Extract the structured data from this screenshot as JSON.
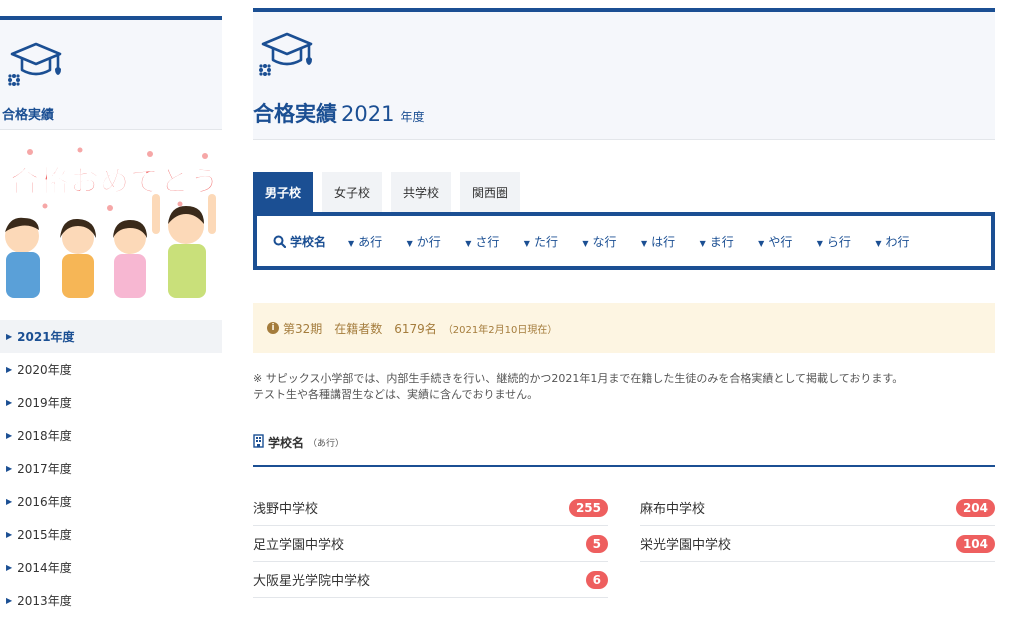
{
  "sidebar": {
    "title": "合格実績",
    "banner_text": "合格おめでとう",
    "years": [
      {
        "label": "2021年度",
        "active": true
      },
      {
        "label": "2020年度"
      },
      {
        "label": "2019年度"
      },
      {
        "label": "2018年度"
      },
      {
        "label": "2017年度"
      },
      {
        "label": "2016年度"
      },
      {
        "label": "2015年度"
      },
      {
        "label": "2014年度"
      },
      {
        "label": "2013年度"
      }
    ]
  },
  "header": {
    "title": "合格実績",
    "year": "2021",
    "suffix": "年度"
  },
  "tabs": [
    "男子校",
    "女子校",
    "共学校",
    "関西圏"
  ],
  "kana_nav": {
    "label": "学校名",
    "items": [
      "あ行",
      "か行",
      "さ行",
      "た行",
      "な行",
      "は行",
      "ま行",
      "や行",
      "ら行",
      "わ行"
    ]
  },
  "notice": {
    "main": "第32期　在籍者数　6179名",
    "date": "（2021年2月10日現在）"
  },
  "note": {
    "line1": "※ サピックス小学部では、内部生手続きを行い、継続的かつ2021年1月まで在籍した生徒のみを合格実績として掲載しております。",
    "line2": "テスト生や各種講習生などは、実績に含んでおりません。"
  },
  "section": {
    "title": "学校名",
    "subtitle": "（あ行）"
  },
  "schools_left": [
    {
      "name": "浅野中学校",
      "count": "255"
    },
    {
      "name": "足立学園中学校",
      "count": "5"
    },
    {
      "name": "大阪星光学院中学校",
      "count": "6"
    }
  ],
  "schools_right": [
    {
      "name": "麻布中学校",
      "count": "204"
    },
    {
      "name": "栄光学園中学校",
      "count": "104"
    }
  ],
  "colors": {
    "brand": "#1b4f93",
    "badge": "#ee5f5f",
    "notice_bg": "#fdf5e2",
    "notice_text": "#a47c3c"
  }
}
